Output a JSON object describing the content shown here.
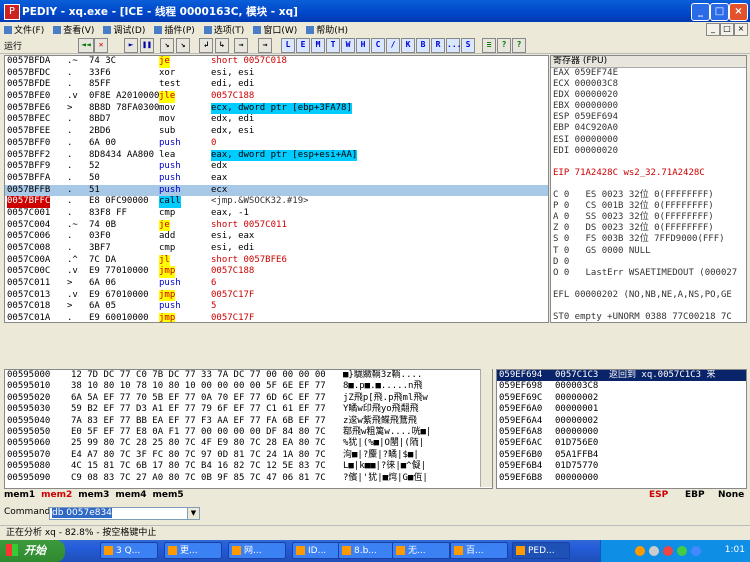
{
  "window": {
    "title": "PEDIY - xq.exe - [ICE - 线程 0000163C, 模块 - xq]"
  },
  "menubar": {
    "items": [
      "文件(F)",
      "查看(V)",
      "调试(D)",
      "插件(P)",
      "选项(T)",
      "窗口(W)",
      "帮助(H)"
    ]
  },
  "toolbar": {
    "status": "运行",
    "buttons": [
      "◄◄",
      "✕",
      "►",
      "❚❚",
      "↘",
      "↘",
      "↲",
      "↳",
      "→",
      "→",
      "L",
      "E",
      "M",
      "T",
      "W",
      "H",
      "C",
      "/",
      "K",
      "B",
      "R",
      "...",
      "S",
      "≡",
      "?",
      "?"
    ]
  },
  "cpu": {
    "rows": [
      {
        "addr": "0057BFDA",
        "arrow": ".~",
        "hex": "74 3C",
        "mn": "je",
        "mntype": "j",
        "op": "short 0057C018",
        "optype": "j"
      },
      {
        "addr": "0057BFDC",
        "arrow": ".",
        "hex": "33F6",
        "mn": "xor",
        "mntype": "",
        "op": "esi, esi",
        "optype": ""
      },
      {
        "addr": "0057BFDE",
        "arrow": ".",
        "hex": "85FF",
        "mn": "test",
        "mntype": "",
        "op": "edi, edi",
        "optype": ""
      },
      {
        "addr": "0057BFE0",
        "arrow": ".v",
        "hex": "0F8E A2010000",
        "mn": "jle",
        "mntype": "j",
        "op": "0057C188",
        "optype": "j"
      },
      {
        "addr": "0057BFE6",
        "arrow": ">",
        "hex": "8B8D 78FA0300",
        "mn": "mov",
        "mntype": "",
        "op": "ecx, dword ptr [ebp+3FA78]",
        "optype": "hl"
      },
      {
        "addr": "0057BFEC",
        "arrow": ".",
        "hex": "8BD7",
        "mn": "mov",
        "mntype": "",
        "op": "edx, edi",
        "optype": ""
      },
      {
        "addr": "0057BFEE",
        "arrow": ".",
        "hex": "2BD6",
        "mn": "sub",
        "mntype": "",
        "op": "edx, esi",
        "optype": ""
      },
      {
        "addr": "0057BFF0",
        "arrow": ".",
        "hex": "6A 00",
        "mn": "push",
        "mntype": "p",
        "op": "0",
        "optype": "j"
      },
      {
        "addr": "0057BFF2",
        "arrow": ".",
        "hex": "8D8434 AA800",
        "mn": "lea",
        "mntype": "",
        "op": "eax, dword ptr [esp+esi+AA]",
        "optype": "hl"
      },
      {
        "addr": "0057BFF9",
        "arrow": ".",
        "hex": "52",
        "mn": "push",
        "mntype": "p",
        "op": "edx",
        "optype": ""
      },
      {
        "addr": "0057BFFA",
        "arrow": ".",
        "hex": "50",
        "mn": "push",
        "mntype": "p",
        "op": "eax",
        "optype": ""
      },
      {
        "addr": "0057BFFB",
        "arrow": ".",
        "hex": "51",
        "mn": "push",
        "mntype": "p",
        "op": "ecx",
        "optype": "",
        "sel": true
      },
      {
        "addr": "0057BFFC",
        "arrow": ".",
        "hex": "E8 0FC90000",
        "mn": "call",
        "mntype": "c",
        "op": "<jmp.&WSOCK32.#19>",
        "optype": "c",
        "bp": true
      },
      {
        "addr": "0057C001",
        "arrow": ".",
        "hex": "83F8 FF",
        "mn": "cmp",
        "mntype": "",
        "op": "eax, -1",
        "optype": ""
      },
      {
        "addr": "0057C004",
        "arrow": ".~",
        "hex": "74 0B",
        "mn": "je",
        "mntype": "j",
        "op": "short 0057C011",
        "optype": "j"
      },
      {
        "addr": "0057C006",
        "arrow": ".",
        "hex": "03F0",
        "mn": "add",
        "mntype": "",
        "op": "esi, eax",
        "optype": ""
      },
      {
        "addr": "0057C008",
        "arrow": ".",
        "hex": "3BF7",
        "mn": "cmp",
        "mntype": "",
        "op": "esi, edi",
        "optype": ""
      },
      {
        "addr": "0057C00A",
        "arrow": ".^",
        "hex": "7C DA",
        "mn": "jl",
        "mntype": "j",
        "op": "short 0057BFE6",
        "optype": "j"
      },
      {
        "addr": "0057C00C",
        "arrow": ".v",
        "hex": "E9 77010000",
        "mn": "jmp",
        "mntype": "j",
        "op": "0057C188",
        "optype": "j"
      },
      {
        "addr": "0057C011",
        "arrow": ">",
        "hex": "6A 06",
        "mn": "push",
        "mntype": "p",
        "op": "6",
        "optype": "j"
      },
      {
        "addr": "0057C013",
        "arrow": ".v",
        "hex": "E9 67010000",
        "mn": "jmp",
        "mntype": "j",
        "op": "0057C17F",
        "optype": "j"
      },
      {
        "addr": "0057C018",
        "arrow": ">",
        "hex": "6A 05",
        "mn": "push",
        "mntype": "p",
        "op": "5",
        "optype": "j"
      },
      {
        "addr": "0057C01A",
        "arrow": ".",
        "hex": "E9 60010000",
        "mn": "jmp",
        "mntype": "j",
        "op": "0057C17F",
        "optype": "j"
      }
    ]
  },
  "registers": {
    "header": "寄存器 (FPU)",
    "lines": [
      {
        "t": "EAX 059EF74E"
      },
      {
        "t": "ECX 000003C8"
      },
      {
        "t": "EDX 00000020"
      },
      {
        "t": "EBX 00000000"
      },
      {
        "t": "ESP 059EF694"
      },
      {
        "t": "EBP 04C920A0"
      },
      {
        "t": "ESI 00000000"
      },
      {
        "t": "EDI 00000020"
      },
      {
        "t": ""
      },
      {
        "t": "EIP 71A2428C ws2_32.71A2428C",
        "red": true
      },
      {
        "t": ""
      },
      {
        "t": "C 0   ES 0023 32位 0(FFFFFFFF)"
      },
      {
        "t": "P 0   CS 001B 32位 0(FFFFFFFF)"
      },
      {
        "t": "A 0   SS 0023 32位 0(FFFFFFFF)"
      },
      {
        "t": "Z 0   DS 0023 32位 0(FFFFFFFF)"
      },
      {
        "t": "S 0   FS 003B 32位 7FFD9000(FFF)"
      },
      {
        "t": "T 0   GS 0000 NULL"
      },
      {
        "t": "D 0"
      },
      {
        "t": "O 0   LastErr WSAETIMEDOUT (000027"
      },
      {
        "t": ""
      },
      {
        "t": "EFL 00000202 (NO,NB,NE,A,NS,PO,GE"
      },
      {
        "t": ""
      },
      {
        "t": "ST0 empty +UNORM 0388 77C00218 7C"
      },
      {
        "t": "ST1 empty 0.0184195495281447210e-"
      },
      {
        "t": "ST2 empty +UNORM 001D 77C002FC 00"
      },
      {
        "t": "ST3 empty +UNORM 7EB4 0000001D 00"
      },
      {
        "t": "ST4 empty +UNORM 6165 62613531 00"
      },
      {
        "t": "ST5 empty +UNORM 3733 2F37322F 33"
      }
    ]
  },
  "dump": {
    "rows": [
      {
        "a": "00595000",
        "h": "12 7D DC 77 C0 7B DC 77 33 7A DC 77 00 00 00 00",
        "s": "■}駹覹鞝3z鞝...."
      },
      {
        "a": "00595010",
        "h": "38 10 80 10 78 10 80 10 00 00 00 00 5F 6E EF 77",
        "s": "8■.p■.■.....n飛"
      },
      {
        "a": "00595020",
        "h": "6A 5A EF 77 70 5B EF 77 0A 70 EF 77 6D 6C EF 77",
        "s": "jZ飛p[飛.p飛ml飛w"
      },
      {
        "a": "00595030",
        "h": "59 B2 EF 77 D3 A1 EF 77 79 6F EF 77 C1 61 EF 77",
        "s": "Y瞲w印飛yo飛翷飛"
      },
      {
        "a": "00595040",
        "h": "7A 83 EF 77 BB EA EF 77 F3 AA EF 77 FA 6B EF 77",
        "s": "z逡w紫飛鲽飛鵞飛"
      },
      {
        "a": "00595050",
        "h": "E0 5F EF 77 E8 0A F1 77 00 00 00 00 DF 84 80 7C",
        "s": "鄀飛w粗篱w....咣■|"
      },
      {
        "a": "00595060",
        "h": "25 99 80 7C 28 25 80 7C 4F E9 80 7C 28 EA 80 7C",
        "s": "%犹|(%■|O闉|(陑|"
      },
      {
        "a": "00595070",
        "h": "E4 A7 80 7C 3F FC 80 7C 97 0D 81 7C 24 1A 80 7C",
        "s": "洵■|?麜|?瞲|$■|"
      },
      {
        "a": "00595080",
        "h": "4C 15 81 7C 6B 17 80 7C B4 16 82 7C 12 5E 83 7C",
        "s": "L■|k■■|?徕|■^儗|"
      },
      {
        "a": "00595090",
        "h": "C9 08 83 7C 27 A0 80 7C 0B 9F 85 7C 47 06 81 7C",
        "s": "?儐|'犹|■焪|G■仾|"
      }
    ]
  },
  "stack": {
    "rows": [
      {
        "a": "059EF694",
        "v": "0057C1C3",
        "c": "返回到 xq.0057C1C3 来",
        "sel": true
      },
      {
        "a": "059EF698",
        "v": "000003C8",
        "c": ""
      },
      {
        "a": "059EF69C",
        "v": "00000002",
        "c": ""
      },
      {
        "a": "059EF6A0",
        "v": "00000001",
        "c": ""
      },
      {
        "a": "059EF6A4",
        "v": "00000002",
        "c": ""
      },
      {
        "a": "059EF6A8",
        "v": "00000000",
        "c": ""
      },
      {
        "a": "059EF6AC",
        "v": "01D756E0",
        "c": ""
      },
      {
        "a": "059EF6B0",
        "v": "05A1FFB4",
        "c": ""
      },
      {
        "a": "059EF6B4",
        "v": "01D75770",
        "c": ""
      },
      {
        "a": "059EF6B8",
        "v": "00000000",
        "c": ""
      }
    ]
  },
  "memtabs": {
    "tabs": [
      "mem1",
      "mem2",
      "mem3",
      "mem4",
      "mem5"
    ],
    "active": 1,
    "regs": [
      "ESP",
      "EBP",
      "None"
    ]
  },
  "command": {
    "label": "Command",
    "value": "db 0057e834"
  },
  "statusbar": {
    "text": "正在分析 xq - 82.8% - 按空格键中止"
  },
  "taskbar": {
    "start": "开始",
    "tasks": [
      "3 Q...",
      "更...",
      "网...",
      "ID...",
      "8.b...",
      "无...",
      "百...",
      "PED..."
    ],
    "active_task": 7,
    "clock": "1:01"
  }
}
